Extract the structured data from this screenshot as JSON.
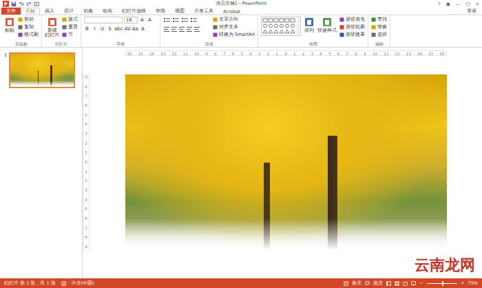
{
  "window": {
    "logo": "P",
    "title": "演示文稿1 - PowerPoint",
    "controls": [
      "?",
      "▣",
      "—",
      "▢",
      "×"
    ]
  },
  "tabs": [
    {
      "label": "文件",
      "kind": "file",
      "selected": false
    },
    {
      "label": "开始",
      "kind": "tab",
      "selected": true
    },
    {
      "label": "插入",
      "kind": "tab",
      "selected": false
    },
    {
      "label": "设计",
      "kind": "tab",
      "selected": false
    },
    {
      "label": "切换",
      "kind": "tab",
      "selected": false
    },
    {
      "label": "动画",
      "kind": "tab",
      "selected": false
    },
    {
      "label": "幻灯片放映",
      "kind": "tab",
      "selected": false
    },
    {
      "label": "审阅",
      "kind": "tab",
      "selected": false
    },
    {
      "label": "视图",
      "kind": "tab",
      "selected": false
    },
    {
      "label": "开发工具",
      "kind": "tab",
      "selected": false
    },
    {
      "label": "Acrobat",
      "kind": "tab",
      "selected": false
    }
  ],
  "account": "登录",
  "ribbon": {
    "groups": [
      {
        "label": "剪贴板",
        "items": [
          {
            "kind": "large",
            "label": "粘贴"
          },
          {
            "kind": "small",
            "label": "剪切"
          },
          {
            "kind": "small",
            "label": "复制"
          },
          {
            "kind": "small",
            "label": "格式刷"
          }
        ]
      },
      {
        "label": "幻灯片",
        "items": [
          {
            "kind": "large",
            "label": "新建\n幻灯片"
          },
          {
            "kind": "small",
            "label": "版式"
          },
          {
            "kind": "small",
            "label": "重置"
          },
          {
            "kind": "small",
            "label": "节"
          }
        ]
      },
      {
        "label": "字体",
        "items": [
          {
            "kind": "field",
            "label": ""
          },
          {
            "kind": "field",
            "label": "18"
          },
          {
            "kind": "glyph",
            "label": "A"
          },
          {
            "kind": "glyph",
            "label": "A"
          },
          {
            "kind": "glyph",
            "label": "B"
          },
          {
            "kind": "glyph",
            "label": "I"
          },
          {
            "kind": "glyph",
            "label": "U"
          },
          {
            "kind": "glyph",
            "label": "S"
          },
          {
            "kind": "glyph",
            "label": "abc"
          },
          {
            "kind": "glyph",
            "label": "AV"
          },
          {
            "kind": "glyph",
            "label": "Aa"
          },
          {
            "kind": "glyph",
            "label": "A"
          }
        ]
      },
      {
        "label": "段落",
        "items": [
          {
            "kind": "para"
          },
          {
            "kind": "small",
            "label": "文字方向"
          },
          {
            "kind": "small",
            "label": "对齐文本"
          },
          {
            "kind": "small",
            "label": "转换为 SmartArt"
          }
        ]
      },
      {
        "label": "绘图",
        "items": [
          {
            "kind": "gallery"
          },
          {
            "kind": "large",
            "label": "排列"
          },
          {
            "kind": "large",
            "label": "快速样式"
          },
          {
            "kind": "small",
            "label": "形状填充"
          },
          {
            "kind": "small",
            "label": "形状轮廓"
          },
          {
            "kind": "small",
            "label": "形状效果"
          }
        ]
      },
      {
        "label": "编辑",
        "items": [
          {
            "kind": "small",
            "label": "查找"
          },
          {
            "kind": "small",
            "label": "替换"
          },
          {
            "kind": "small",
            "label": "选择"
          }
        ]
      }
    ]
  },
  "thumbnails": [
    {
      "number": "1",
      "selected": true
    }
  ],
  "rulers": {
    "horizontal": [
      "16",
      "15",
      "14",
      "13",
      "12",
      "11",
      "10",
      "9",
      "8",
      "7",
      "6",
      "5",
      "4",
      "3",
      "2",
      "1",
      "0",
      "1",
      "2",
      "3",
      "4",
      "5",
      "6",
      "7",
      "8",
      "9",
      "10",
      "11",
      "12",
      "13",
      "14",
      "15",
      "16"
    ],
    "vertical": [
      "9",
      "8",
      "7",
      "6",
      "5",
      "4",
      "3",
      "2",
      "1",
      "0",
      "1",
      "2",
      "3",
      "4",
      "5",
      "6",
      "7",
      "8",
      "9"
    ]
  },
  "status_bar": {
    "slide_info": "幻灯片 第 1 张，共 1 张",
    "language": "中文(中国)",
    "notes": "备注",
    "comments": "批注",
    "zoom_out": "−",
    "zoom_in": "+",
    "zoom": "75%",
    "zoom_level": 0.5
  },
  "watermark": "云南龙网"
}
